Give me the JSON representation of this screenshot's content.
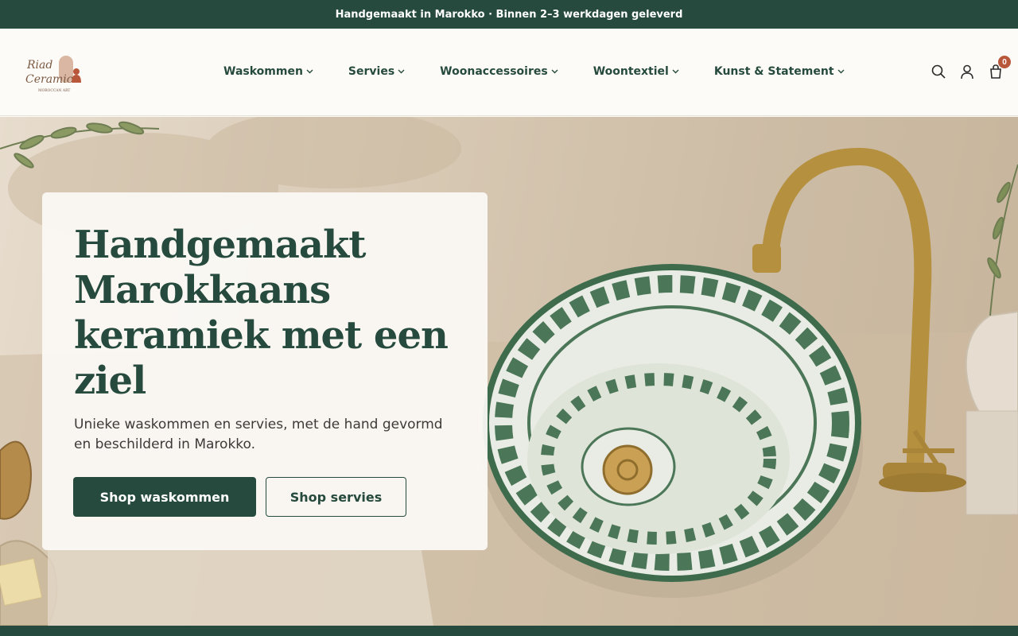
{
  "announcement": "Handgemaakt in Marokko · Binnen 2–3 werkdagen geleverd",
  "brand": {
    "name_line1": "Riad",
    "name_line2": "Ceramic",
    "tagline": "MOROCCAN ART"
  },
  "nav": [
    {
      "label": "Waskommen"
    },
    {
      "label": "Servies"
    },
    {
      "label": "Woonaccessoires"
    },
    {
      "label": "Woontextiel"
    },
    {
      "label": "Kunst & Statement"
    }
  ],
  "header_icons": [
    "search-icon",
    "account-icon",
    "cart-icon"
  ],
  "cart": {
    "count": "0"
  },
  "hero": {
    "title": "Handgemaakt Marokkaans keramiek met een ziel",
    "subtitle": "Unieke waskommen en servies, met de hand gevormd en beschilderd in Marokko.",
    "primary_cta": "Shop waskommen",
    "secondary_cta": "Shop servies"
  },
  "colors": {
    "brand_green": "#264a3d",
    "accent_terracotta": "#b9573a",
    "background": "#fdfbf7"
  }
}
